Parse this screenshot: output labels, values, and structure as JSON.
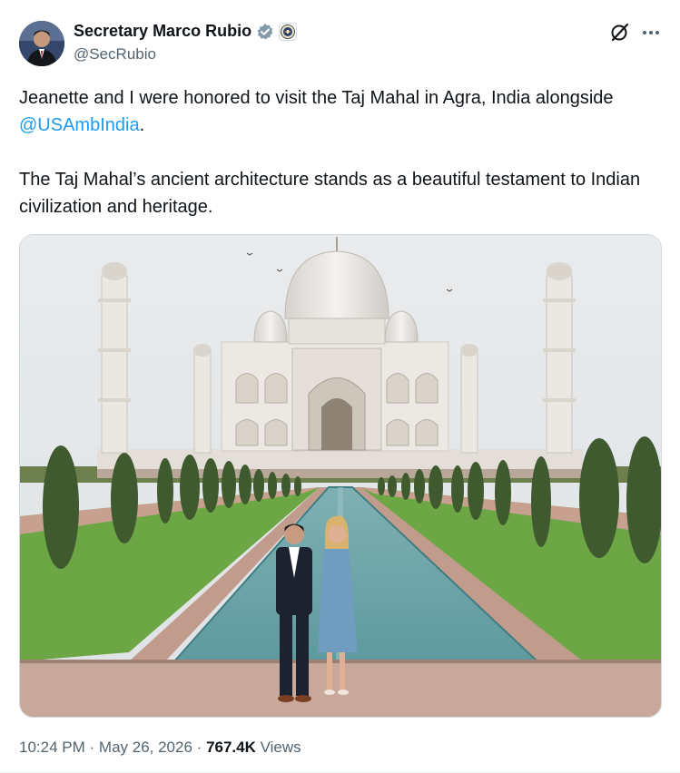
{
  "author": {
    "display_name": "Secretary Marco Rubio",
    "handle": "@SecRubio",
    "verified_badge_icon": "verified-badge-icon",
    "affiliation_icon": "state-department-seal-icon"
  },
  "header_actions": {
    "grok_icon": "grok-icon",
    "more_icon": "more-options-icon"
  },
  "tweet": {
    "paragraph1_before": "Jeanette and I were honored to visit the Taj Mahal in Agra, India alongside ",
    "mention": "@USAmbIndia",
    "paragraph1_after": ".",
    "paragraph2": "The Taj Mahal’s ancient architecture stands as a beautiful testament to Indian civilization and heritage."
  },
  "photo": {
    "subject": "Taj Mahal with couple standing at reflecting pool"
  },
  "meta": {
    "time": "10:24 PM",
    "separator": "·",
    "date": "May 26, 2026",
    "views_count": "767.4K",
    "views_word": "Views"
  },
  "colors": {
    "link": "#1d9bf0",
    "secondary_text": "#536471",
    "primary_text": "#0f1419"
  }
}
